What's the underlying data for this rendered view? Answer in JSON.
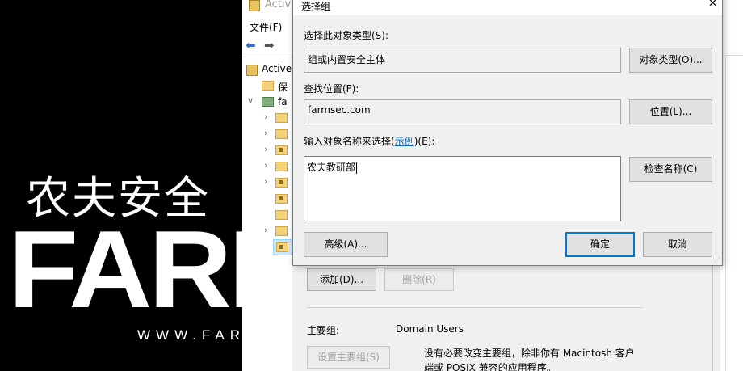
{
  "brand": {
    "cn_text": "农夫安全",
    "en_text": "FARM",
    "url_text": "WWW.FAR"
  },
  "ad_window": {
    "title": "Activ",
    "menu": {
      "file": "文件(F)"
    },
    "tree": {
      "root_label": "Active",
      "item_1_label": "保",
      "item_2_label": "fa"
    }
  },
  "properties": {
    "add_button": "添加(D)...",
    "remove_button": "删除(R)",
    "primary_group_label": "主要组:",
    "primary_group_value": "Domain Users",
    "set_primary_button": "设置主要组(S)",
    "primary_group_note": "没有必要改变主要组，除非你有 Macintosh 客户端或 POSIX 兼容的应用程序。"
  },
  "dialog": {
    "title": "选择组",
    "object_type_label": "选择此对象类型(S):",
    "object_type_value": "组或内置安全主体",
    "object_type_button": "对象类型(O)...",
    "location_label": "查找位置(F):",
    "location_value": "farmsec.com",
    "location_button": "位置(L)...",
    "enter_names_label_prefix": "输入对象名称来选择(",
    "enter_names_link": "示例",
    "enter_names_label_suffix": ")(E):",
    "enter_names_value": "农夫教研部",
    "check_names_button": "检查名称(C)",
    "advanced_button": "高级(A)...",
    "ok_button": "确定",
    "cancel_button": "取消"
  },
  "colors": {
    "accent": "#0078d7",
    "link": "#0066cc",
    "dialog_bg": "#f0f0f0"
  }
}
